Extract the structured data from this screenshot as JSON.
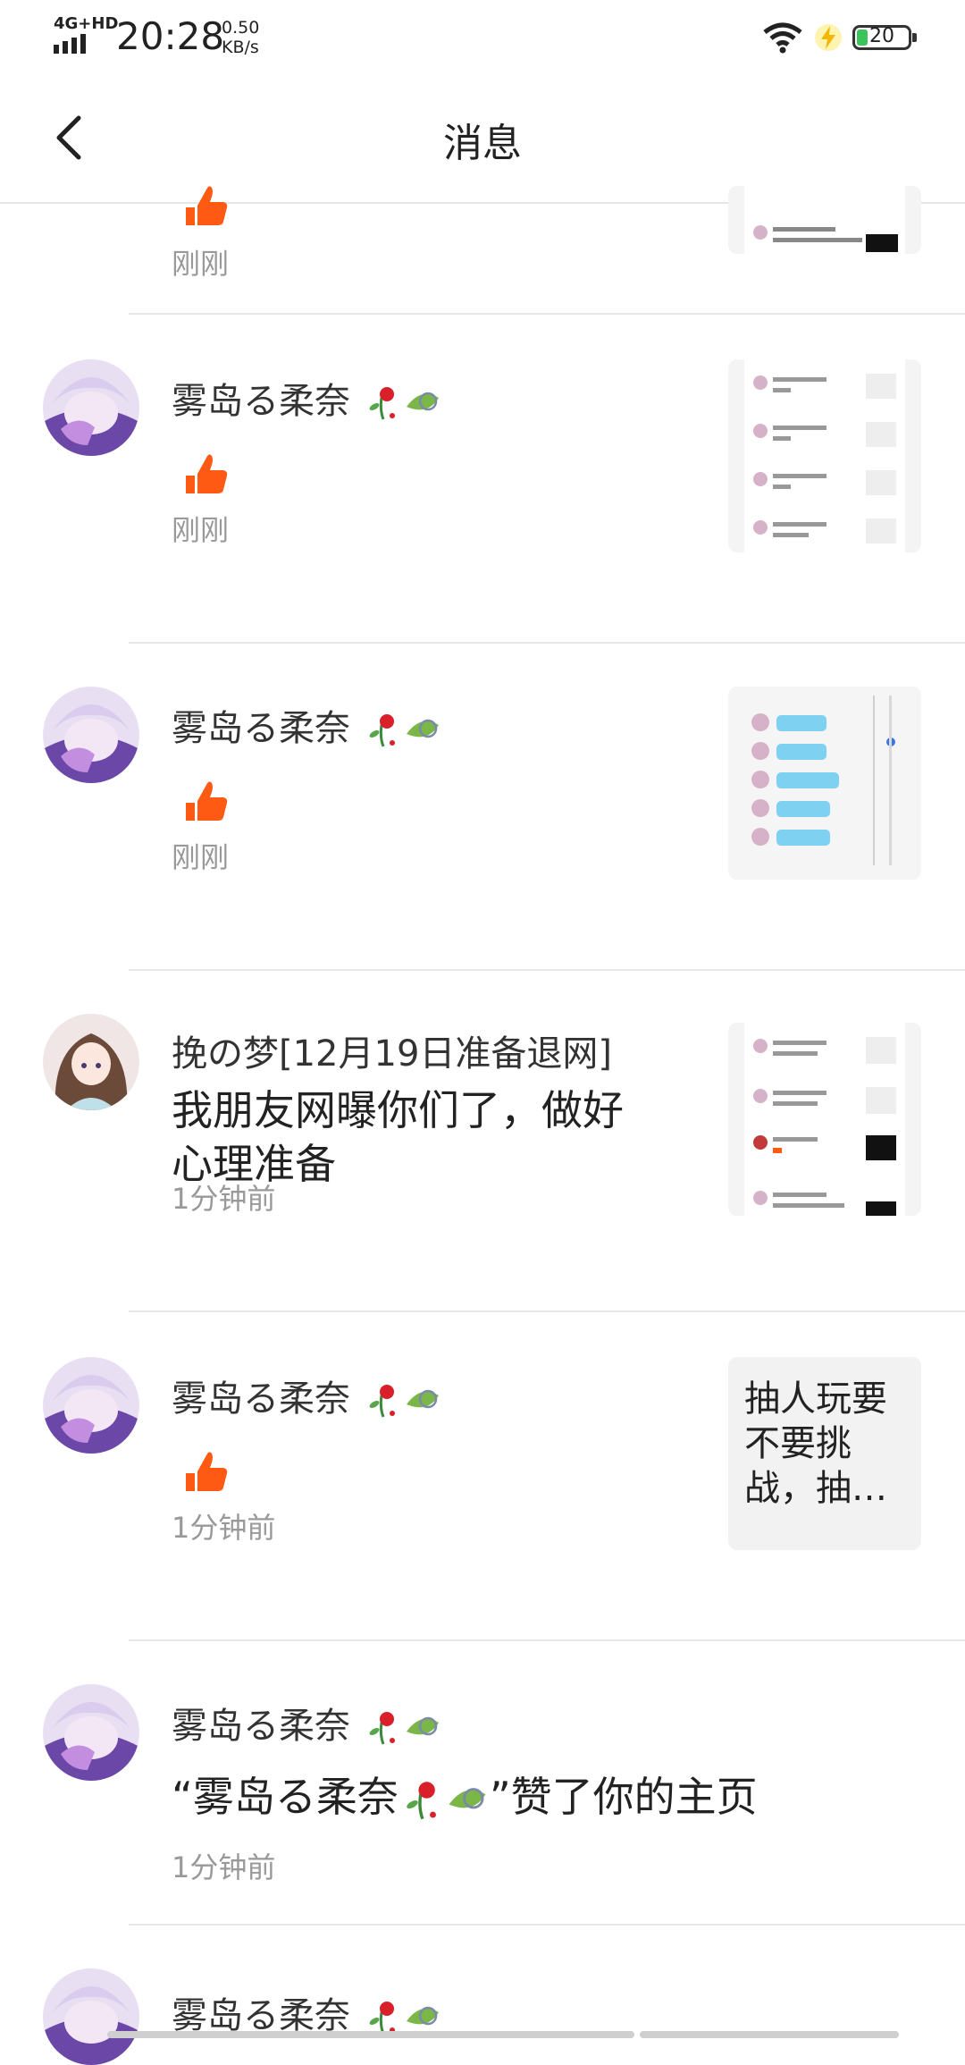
{
  "status_bar": {
    "network": "4G+HD",
    "time": "20:28",
    "speed_value": "0.50",
    "speed_unit": "KB/s",
    "battery": "20"
  },
  "header": {
    "title": "消息"
  },
  "notifications": [
    {
      "time": "刚刚"
    },
    {
      "name": "雾岛る柔奈",
      "type": "like",
      "time": "刚刚"
    },
    {
      "name": "雾岛る柔奈",
      "type": "like",
      "time": "刚刚"
    },
    {
      "name": "挽の梦[12月19日准备退网]",
      "content_line1": "我朋友网曝你们了，做好",
      "content_line2": "心理准备",
      "time": "1分钟前"
    },
    {
      "name": "雾岛る柔奈",
      "type": "like",
      "time": "1分钟前",
      "thumb_text": "抽人玩要不要挑战，抽…"
    },
    {
      "name": "雾岛る柔奈",
      "content_prefix": "“雾岛る柔奈",
      "content_suffix": "”赞了你的主页",
      "time": "1分钟前"
    },
    {
      "name": "雾岛る柔奈"
    }
  ],
  "colors": {
    "like": "#ff5a14",
    "divider": "#e8e8e8",
    "time_text": "#999999"
  }
}
